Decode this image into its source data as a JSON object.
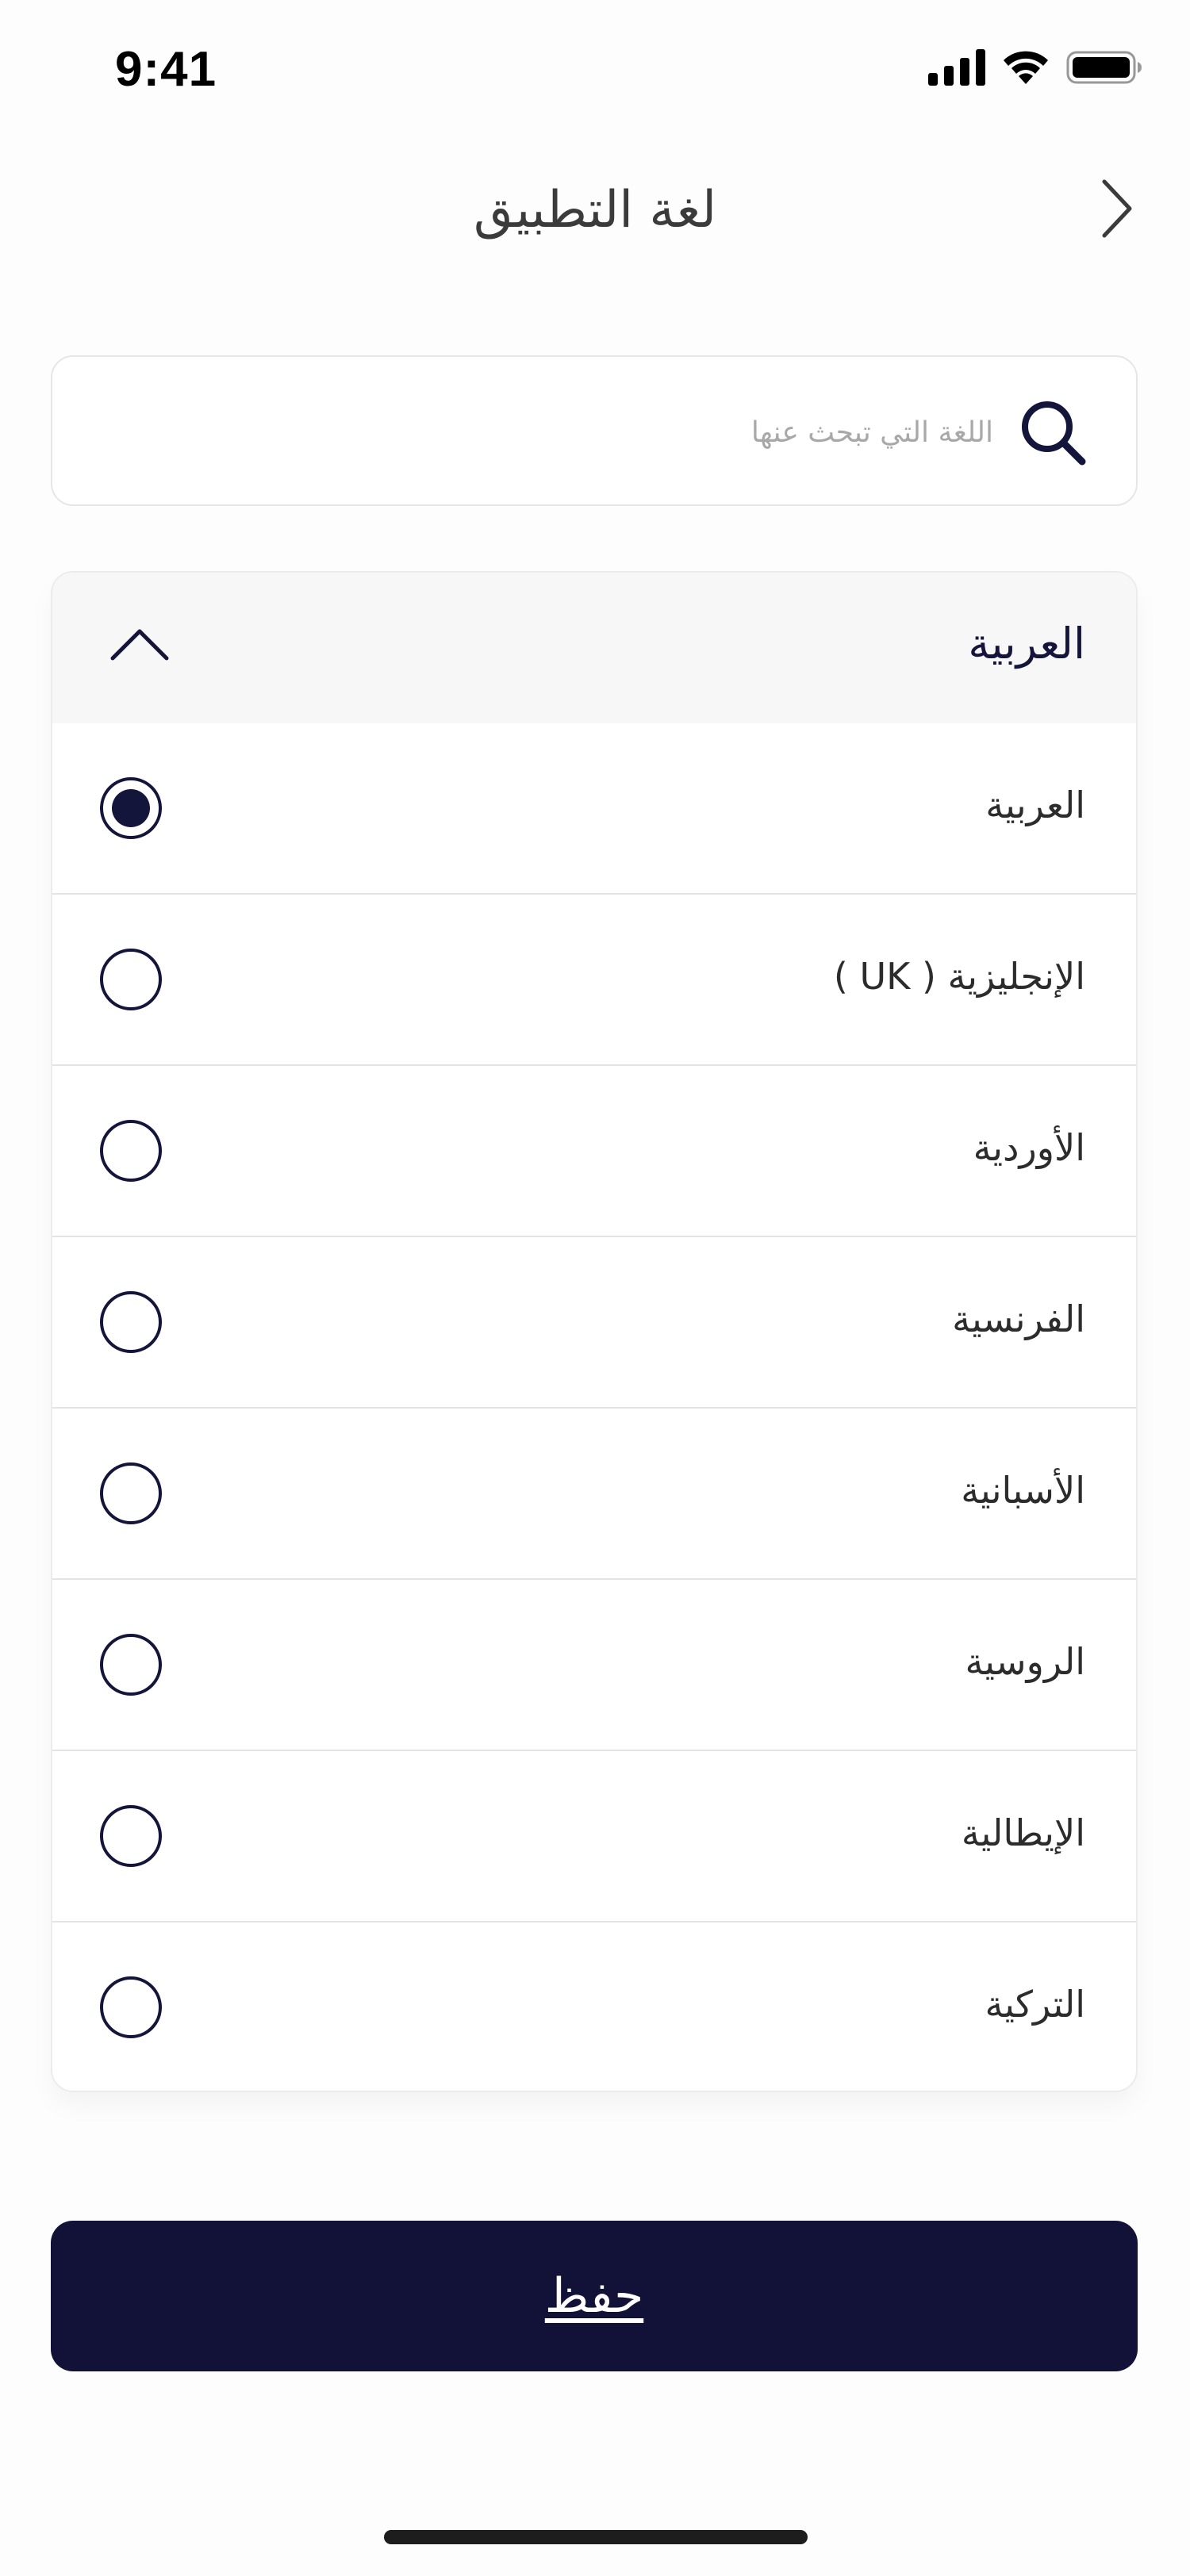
{
  "status_bar": {
    "time": "9:41"
  },
  "header": {
    "title": "لغة التطبيق",
    "back_icon": "chevron-right-icon"
  },
  "search": {
    "placeholder": "اللغة التي تبحث عنها",
    "value": "",
    "icon": "search-icon"
  },
  "language_card": {
    "title": "العربية",
    "expanded": true,
    "toggle_icon": "chevron-up-icon",
    "items": [
      {
        "label": "العربية",
        "selected": true
      },
      {
        "label": "الإنجليزية ( UK )",
        "selected": false
      },
      {
        "label": "الأوردية",
        "selected": false
      },
      {
        "label": "الفرنسية",
        "selected": false
      },
      {
        "label": "الأسبانية",
        "selected": false
      },
      {
        "label": "الروسية",
        "selected": false
      },
      {
        "label": "الإيطالية",
        "selected": false
      },
      {
        "label": "التركية",
        "selected": false
      }
    ]
  },
  "save_button": {
    "label": "حفظ"
  },
  "colors": {
    "primary": "#121238",
    "radio_border": "#14153a",
    "card_header_bg": "#f7f7f7",
    "divider": "#e4e4e4",
    "placeholder": "#a8a8a8"
  }
}
